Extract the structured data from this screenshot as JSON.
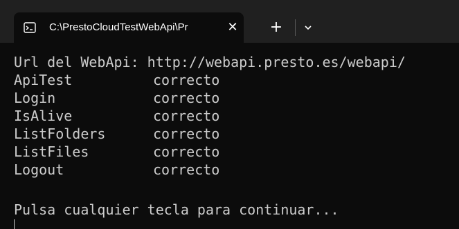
{
  "tab": {
    "icon": "terminal-icon",
    "title": "C:\\PrestoCloudTestWebApi\\Pr",
    "close_icon": "close-icon",
    "close_glyph": "✕",
    "new_tab_icon": "plus-icon",
    "new_tab_glyph": "+",
    "dropdown_icon": "chevron-down-icon"
  },
  "console": {
    "url_line": "Url del WebApi: http://webapi.presto.es/webapi/",
    "results": [
      {
        "name": "ApiTest",
        "status": "correcto"
      },
      {
        "name": "Login",
        "status": "correcto"
      },
      {
        "name": "IsAlive",
        "status": "correcto"
      },
      {
        "name": "ListFolders",
        "status": "correcto"
      },
      {
        "name": "ListFiles",
        "status": "correcto"
      },
      {
        "name": "Logout",
        "status": "correcto"
      }
    ],
    "prompt": "Pulsa cualquier tecla para continuar..."
  },
  "colors": {
    "titlebar": "#202020",
    "background": "#0c0c0c",
    "text": "#cccccc"
  }
}
